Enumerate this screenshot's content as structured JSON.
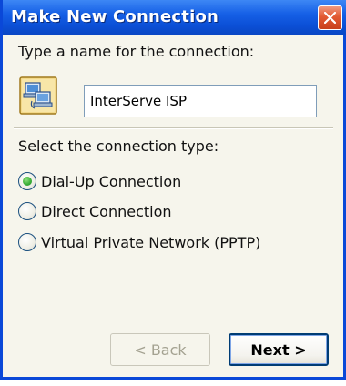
{
  "window": {
    "title": "Make New Connection"
  },
  "name_section": {
    "prompt": "Type a name for the connection:",
    "input_value": "InterServe ISP"
  },
  "type_section": {
    "prompt": "Select the connection type:",
    "options": [
      {
        "label": "Dial-Up Connection",
        "checked": true
      },
      {
        "label": "Direct Connection",
        "checked": false
      },
      {
        "label": "Virtual Private Network (PPTP)",
        "checked": false
      }
    ]
  },
  "buttons": {
    "back_label": "< Back",
    "next_label": "Next >"
  },
  "icons": {
    "close": "close-icon",
    "connection": "network-connection-icon"
  },
  "colors": {
    "titlebar": "#0b4fd6",
    "close_button": "#e25a33",
    "radio_checked": "#3db03a",
    "window_background": "#f6f5ec"
  }
}
